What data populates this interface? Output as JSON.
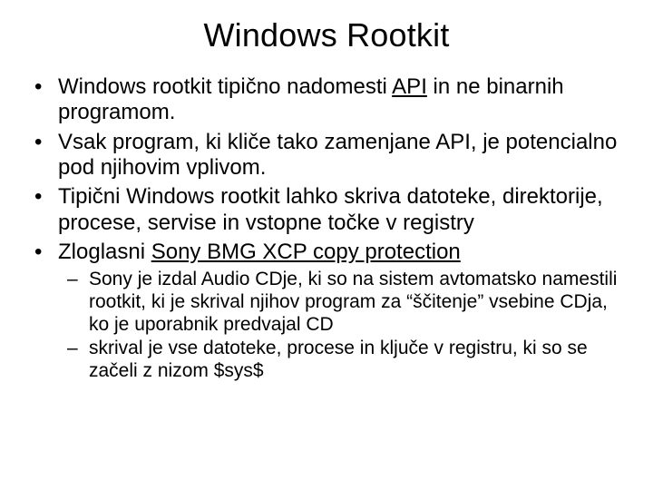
{
  "title": "Windows Rootkit",
  "bullets": {
    "b0_a": "Windows rootkit tipično nadomesti ",
    "b0_u": "API",
    "b0_b": " in ne binarnih programom.",
    "b1": "Vsak program, ki kliče tako zamenjane API, je potencialno pod njihovim vplivom.",
    "b2": "Tipični Windows rootkit lahko skriva datoteke, direktorije, procese, servise in vstopne točke v registry",
    "b3_a": "Zloglasni ",
    "b3_u": "Sony BMG XCP copy protection",
    "sub0": "Sony je izdal Audio CDje, ki so na sistem avtomatsko namestili rootkit, ki je skrival njihov program za “ščitenje” vsebine CDja, ko je uporabnik predvajal CD",
    "sub1": "skrival je vse datoteke, procese in ključe v registru, ki so se začeli z nizom $sys$"
  }
}
